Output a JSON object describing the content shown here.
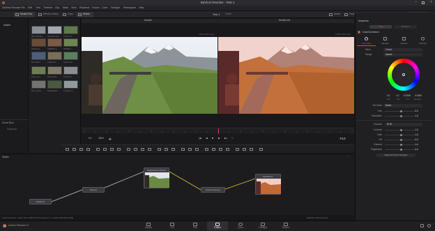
{
  "app": {
    "title": "DaVinci Resolve - Test 1"
  },
  "menu": [
    "DaVinci Resolve",
    "File",
    "Edit",
    "Trim",
    "Timeline",
    "Clip",
    "Mark",
    "View",
    "Playback",
    "Fusion",
    "Color",
    "Fairlight",
    "Workspace",
    "Help"
  ],
  "toolbar": {
    "left": [
      "Media Pool",
      "Effects Library",
      "Clips",
      "Nodes"
    ],
    "project": "Test 1",
    "project_status": "Edited",
    "right": [
      "Spline",
      "Keyframes",
      "Metadata",
      "Inspector"
    ]
  },
  "media_pool": {
    "bins_header": "Master",
    "clips": [
      "SB 6 Windo...",
      "Jumper.mp4",
      "Forest Tr...",
      "Climbing...",
      "SHBIKE 1...",
      "Wildlife L...",
      "Mountain...",
      "Trail Run...",
      "Cabin LX...",
      "Pinto_Dr...",
      "Fireworks...",
      "Northern...",
      "Pile_reduc...",
      "MediaOut1...",
      "Timeline 1"
    ],
    "smart_bins": "Smart Bins",
    "smart_bins_item": "Keywords"
  },
  "viewers": {
    "left_title": "Media1",
    "right_title": "MediaOut1",
    "left_res": "1280x720p/image",
    "right_res": "1280x720p/image",
    "timecode_start": "0.0",
    "timecode_end": "156.0",
    "frame": "74.0",
    "transport": [
      "|◀",
      "◀",
      "■",
      "▶",
      "▶|",
      "↻"
    ]
  },
  "nodes_panel": {
    "title": "Nodes",
    "nodes": [
      {
        "id": "media_in",
        "label": "MediaIn1"
      },
      {
        "id": "merge",
        "label": "Merge1"
      },
      {
        "id": "bright",
        "label": "BrightnessContrast1"
      },
      {
        "id": "colorcorr",
        "label": "ColorCorrector1"
      },
      {
        "id": "media_out",
        "label": "MediaOut1"
      }
    ]
  },
  "status": {
    "left": "ColorCorrector1 - Frame Size 1280x720, Pixel Aspect 1:1, Depth 16bit float (8 GB)",
    "right_a": "Playback: 30 frames/sec",
    "right_b": "11%  1024 MB"
  },
  "inspector": {
    "title": "Inspector",
    "node": "ColorCorrector1",
    "tabs_top": [
      "Tools",
      "Modifiers"
    ],
    "tabs": [
      "Correction",
      "Ranges",
      "Options",
      "Settings"
    ],
    "menu_label": "Menu",
    "menu_value": "Colors",
    "range_label": "Range",
    "range_value": "Master",
    "wheel_values": [
      "0.0",
      "1.0",
      "0.0255",
      "0.0483"
    ],
    "wheel_value_labels": [
      "Hue",
      "Sat",
      "Tint",
      "Strength"
    ],
    "tint_mode_label": "Tint Mode",
    "tint_mode_value": "Better",
    "rows": [
      {
        "label": "Hue",
        "value": "0.0"
      },
      {
        "label": "Saturation",
        "value": "1.0"
      },
      {
        "label": "Channel",
        "value": "RGB"
      },
      {
        "label": "Contrast",
        "value": "1.0"
      },
      {
        "label": "Gain",
        "value": "1.0"
      },
      {
        "label": "Lift",
        "value": "0.0"
      },
      {
        "label": "Gamma",
        "value": "1.0"
      },
      {
        "label": "Brightness",
        "value": "0.0"
      }
    ],
    "reset_label": "Reset All Color Changes"
  },
  "pages": [
    {
      "label": "Media",
      "active": false
    },
    {
      "label": "Cut",
      "active": false
    },
    {
      "label": "Edit",
      "active": false
    },
    {
      "label": "Fusion",
      "active": true
    },
    {
      "label": "Color",
      "active": false
    },
    {
      "label": "Fairlight",
      "active": false
    },
    {
      "label": "Deliver",
      "active": false
    }
  ],
  "footer": {
    "app_name": "DaVinci Resolve 17"
  }
}
